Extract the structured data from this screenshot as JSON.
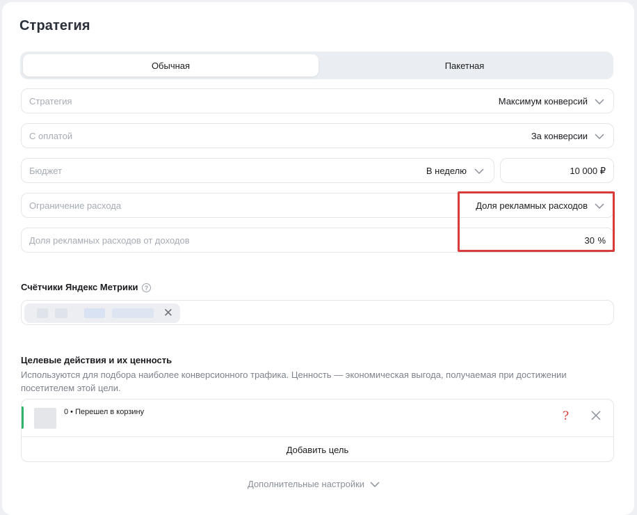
{
  "title": "Стратегия",
  "tabs": [
    "Обычная",
    "Пакетная"
  ],
  "fields": {
    "strategy": {
      "label": "Стратегия",
      "value": "Максимум конверсий"
    },
    "payment": {
      "label": "С оплатой",
      "value": "За конверсии"
    },
    "budget": {
      "label": "Бюджет",
      "period": "В неделю",
      "amount": "10 000 ₽"
    },
    "limit": {
      "label": "Ограничение расхода",
      "value": "Доля рекламных расходов"
    },
    "share": {
      "label": "Доля рекламных расходов от доходов",
      "value": "30",
      "unit": "%"
    }
  },
  "counters": {
    "title": "Счётчики Яндекс Метрики",
    "help": "?",
    "remove": "✕"
  },
  "goals": {
    "title": "Целевые действия и их ценность",
    "description": "Используются для подбора наиболее конверсионного трафика. Ценность — экономическая выгода, получаемая при достижении посетителем этой цели.",
    "items": [
      {
        "text": "0 • Перешел в корзину",
        "annotation": "?"
      }
    ],
    "add_label": "Добавить цель"
  },
  "more_settings": "Дополнительные настройки",
  "colors": {
    "accent_highlight": "#d93a3a",
    "goal_bar": "#2fb36a",
    "placeholder": "#a6abb4"
  },
  "icons": [
    "chevron-down-icon",
    "help-circle-icon",
    "close-icon"
  ]
}
